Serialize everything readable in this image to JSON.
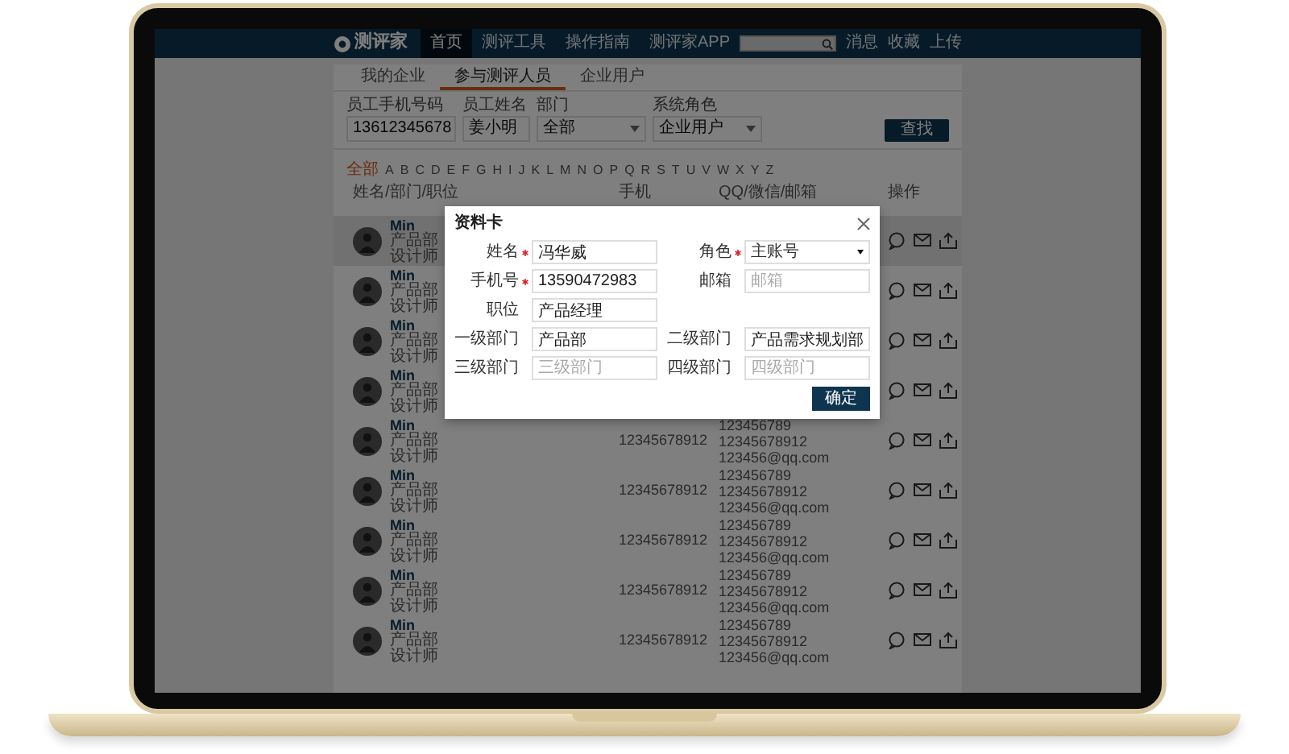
{
  "nav": {
    "logo": "测评家",
    "items": [
      {
        "label": "首页",
        "selected": true
      },
      {
        "label": "测评工具",
        "selected": false
      },
      {
        "label": "操作指南",
        "selected": false
      },
      {
        "label": "测评家APP",
        "selected": false
      }
    ],
    "links": [
      "消息",
      "收藏",
      "上传"
    ]
  },
  "tabs": [
    {
      "label": "我的企业",
      "selected": false
    },
    {
      "label": "参与测评人员",
      "selected": true
    },
    {
      "label": "企业用户",
      "selected": false
    }
  ],
  "filters": [
    {
      "label": "员工手机号码",
      "kind": "text",
      "value": "13612345678"
    },
    {
      "label": "员工姓名",
      "kind": "text",
      "value": "姜小明"
    },
    {
      "label": "部门",
      "kind": "select",
      "value": "全部"
    },
    {
      "label": "系统角色",
      "kind": "select",
      "value": "企业用户"
    }
  ],
  "search_button": "查找",
  "letter_index": [
    {
      "label": "全部",
      "selected": true
    },
    {
      "label": "A",
      "selected": false
    },
    {
      "label": "B",
      "selected": false
    },
    {
      "label": "C",
      "selected": false
    },
    {
      "label": "D",
      "selected": false
    },
    {
      "label": "E",
      "selected": false
    },
    {
      "label": "F",
      "selected": false
    },
    {
      "label": "G",
      "selected": false
    },
    {
      "label": "H",
      "selected": false
    },
    {
      "label": "I",
      "selected": false
    },
    {
      "label": "J",
      "selected": false
    },
    {
      "label": "K",
      "selected": false
    },
    {
      "label": "L",
      "selected": false
    },
    {
      "label": "M",
      "selected": false
    },
    {
      "label": "N",
      "selected": false
    },
    {
      "label": "O",
      "selected": false
    },
    {
      "label": "P",
      "selected": false
    },
    {
      "label": "Q",
      "selected": false
    },
    {
      "label": "R",
      "selected": false
    },
    {
      "label": "S",
      "selected": false
    },
    {
      "label": "T",
      "selected": false
    },
    {
      "label": "U",
      "selected": false
    },
    {
      "label": "V",
      "selected": false
    },
    {
      "label": "W",
      "selected": false
    },
    {
      "label": "X",
      "selected": false
    },
    {
      "label": "Y",
      "selected": false
    },
    {
      "label": "Z",
      "selected": false
    }
  ],
  "columns": [
    "姓名/部门/职位",
    "手机",
    "QQ/微信/邮箱",
    "操作"
  ],
  "rows": [
    {
      "name": "Min",
      "department": "产品部",
      "title": "设计师",
      "highlighted": true
    },
    {
      "name": "Min",
      "department": "产品部",
      "title": "设计师",
      "highlighted": false
    },
    {
      "name": "Min",
      "department": "产品部",
      "title": "设计师",
      "highlighted": false
    },
    {
      "name": "Min",
      "department": "产品部",
      "title": "设计师",
      "highlighted": false
    },
    {
      "name": "Min",
      "department": "产品部",
      "title": "设计师",
      "highlighted": false,
      "phone": "12345678912",
      "contacts": [
        "123456789",
        "12345678912",
        "123456@qq.com"
      ]
    },
    {
      "name": "Min",
      "department": "产品部",
      "title": "设计师",
      "highlighted": false,
      "phone": "12345678912",
      "contacts": [
        "123456789",
        "12345678912",
        "123456@qq.com"
      ]
    },
    {
      "name": "Min",
      "department": "产品部",
      "title": "设计师",
      "highlighted": false,
      "phone": "12345678912",
      "contacts": [
        "123456789",
        "12345678912",
        "123456@qq.com"
      ]
    },
    {
      "name": "Min",
      "department": "产品部",
      "title": "设计师",
      "highlighted": false,
      "phone": "12345678912",
      "contacts": [
        "123456789",
        "12345678912",
        "123456@qq.com"
      ]
    },
    {
      "name": "Min",
      "department": "产品部",
      "title": "设计师",
      "highlighted": false,
      "phone": "12345678912",
      "contacts": [
        "123456789",
        "12345678912",
        "123456@qq.com"
      ]
    }
  ],
  "dialog": {
    "title": "资料卡",
    "rows": [
      [
        {
          "label": "姓名",
          "required": true,
          "kind": "text",
          "value": "冯华威"
        },
        {
          "label": "角色",
          "required": true,
          "kind": "select",
          "value": "主账号"
        }
      ],
      [
        {
          "label": "手机号",
          "required": true,
          "kind": "text",
          "value": "13590472983"
        },
        {
          "label": "邮箱",
          "required": false,
          "kind": "text",
          "placeholder": "邮箱"
        }
      ],
      [
        {
          "label": "职位",
          "required": false,
          "kind": "text",
          "value": "产品经理"
        }
      ],
      [
        {
          "label": "一级部门",
          "required": false,
          "kind": "text",
          "value": "产品部"
        },
        {
          "label": "二级部门",
          "required": false,
          "kind": "text",
          "value": "产品需求规划部"
        }
      ],
      [
        {
          "label": "三级部门",
          "required": false,
          "kind": "text",
          "placeholder": "三级部门"
        },
        {
          "label": "四级部门",
          "required": false,
          "kind": "text",
          "placeholder": "四级部门"
        }
      ]
    ],
    "confirm_button": "确定"
  }
}
